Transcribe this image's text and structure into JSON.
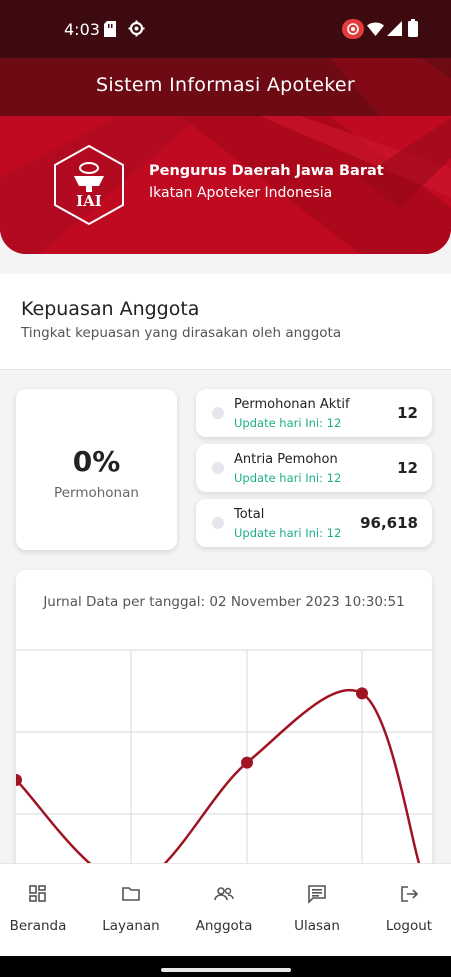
{
  "status_bar": {
    "time": "4:03"
  },
  "header": {
    "app_title": "Sistem Informasi Apoteker",
    "logo_text": "IAI",
    "org_name": "Pengurus Daerah Jawa Barat",
    "org_subtitle": "Ikatan Apoteker Indonesia",
    "accent_color": "#b8081e"
  },
  "section": {
    "title": "Kepuasan Anggota",
    "subtitle": "Tingkat kepuasan yang dirasakan oleh anggota"
  },
  "summary": {
    "percent": "0%",
    "label": "Permohonan"
  },
  "stats": [
    {
      "label": "Permohonan Aktif",
      "update": "Update hari Ini: 12",
      "value": "12"
    },
    {
      "label": "Antria Pemohon",
      "update": "Update hari Ini: 12",
      "value": "12"
    },
    {
      "label": "Total",
      "update": "Update hari Ini: 12",
      "value": "96,618"
    }
  ],
  "chart_data": {
    "type": "line",
    "title": "Jurnal Data per tanggal: 02 November 2023 10:30:51",
    "series": [
      {
        "values": [
          2.0,
          0.8,
          2.2,
          3.0,
          1.0
        ]
      }
    ],
    "ylim": [
      0.5,
      3.5
    ],
    "grid": true,
    "line_color": "#a01322"
  },
  "nav": [
    {
      "label": "Beranda",
      "icon": "dashboard-icon"
    },
    {
      "label": "Layanan",
      "icon": "folder-icon"
    },
    {
      "label": "Anggota",
      "icon": "people-icon"
    },
    {
      "label": "Ulasan",
      "icon": "review-icon"
    },
    {
      "label": "Logout",
      "icon": "logout-icon"
    }
  ]
}
